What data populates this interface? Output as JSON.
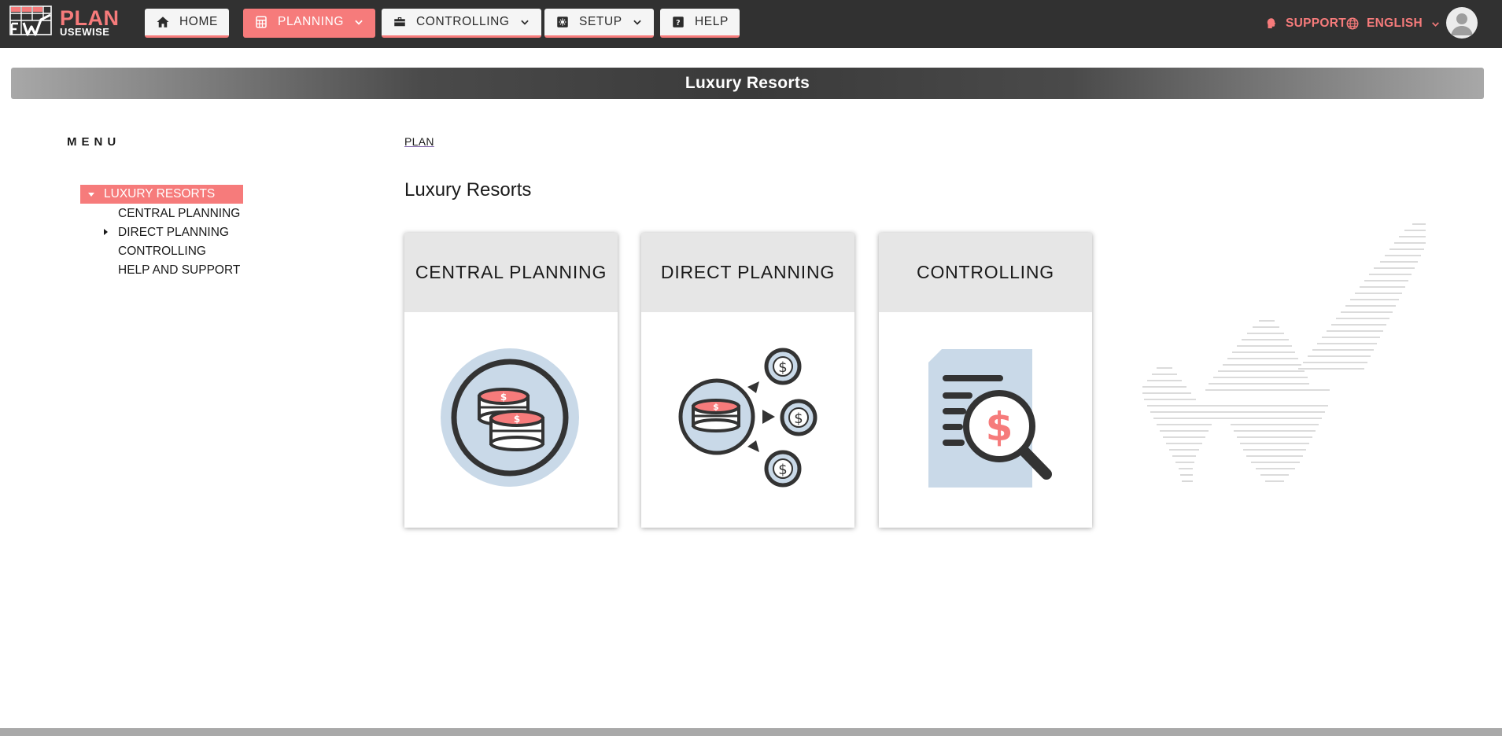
{
  "logo": {
    "line1": "PLAN",
    "line2": "USEWISE"
  },
  "nav": {
    "home": "HOME",
    "planning": "PLANNING",
    "controlling": "CONTROLLING",
    "setup": "SETUP",
    "help": "HELP"
  },
  "topright": {
    "support": "SUPPORT",
    "language": "ENGLISH"
  },
  "banner": {
    "title": "Luxury Resorts"
  },
  "menu": {
    "title": "MENU",
    "root": "LUXURY RESORTS",
    "items": [
      "CENTRAL PLANNING",
      "DIRECT PLANNING",
      "CONTROLLING",
      "HELP AND SUPPORT"
    ]
  },
  "breadcrumb": "PLAN",
  "page_title": "Luxury Resorts",
  "cards": [
    {
      "title": "CENTRAL PLANNING",
      "icon": "coins-circle-icon"
    },
    {
      "title": "DIRECT PLANNING",
      "icon": "distribute-coins-icon"
    },
    {
      "title": "CONTROLLING",
      "icon": "document-magnifier-icon"
    }
  ],
  "colors": {
    "accent": "#f67b7b",
    "topbar": "#313131",
    "icon_fill": "#c9d9e8",
    "icon_stroke": "#333333"
  }
}
